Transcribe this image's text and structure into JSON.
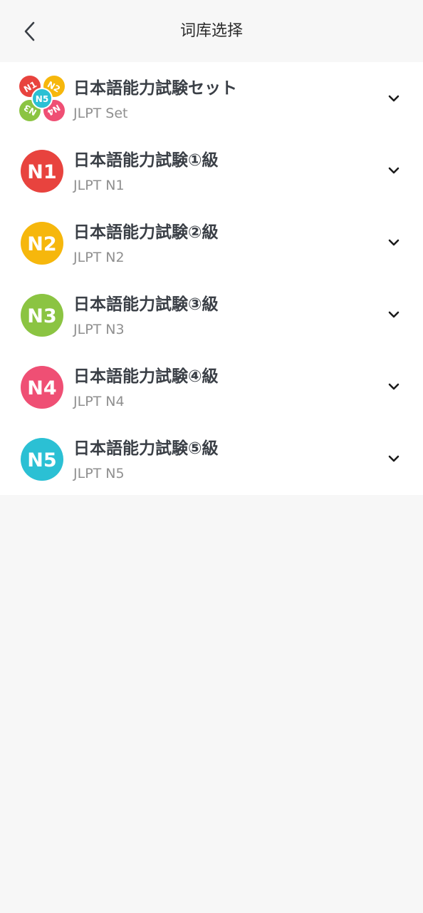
{
  "header": {
    "title": "词库选择",
    "back_icon": "chevron-left-icon"
  },
  "colors": {
    "n1": "#e8433e",
    "n2": "#f6b70c",
    "n3": "#8bc442",
    "n4": "#ef4f74",
    "n5": "#2bc0d4",
    "title_text": "#3a3f46",
    "subtitle_text": "#8f8f8f",
    "background": "#f7f7f7"
  },
  "items": [
    {
      "title": "日本語能力試験セット",
      "subtitle": "JLPT Set",
      "icon": "jlpt-set-logo-icon",
      "logo_labels": [
        "N1",
        "N2",
        "N3",
        "N4",
        "N5"
      ]
    },
    {
      "title": "日本語能力試験①級",
      "subtitle": "JLPT N1",
      "icon": "n1-logo-icon",
      "logo_label": "N1"
    },
    {
      "title": "日本語能力試験②級",
      "subtitle": "JLPT N2",
      "icon": "n2-logo-icon",
      "logo_label": "N2"
    },
    {
      "title": "日本語能力試験③級",
      "subtitle": "JLPT N3",
      "icon": "n3-logo-icon",
      "logo_label": "N3"
    },
    {
      "title": "日本語能力試験④級",
      "subtitle": "JLPT N4",
      "icon": "n4-logo-icon",
      "logo_label": "N4"
    },
    {
      "title": "日本語能力試験⑤級",
      "subtitle": "JLPT N5",
      "icon": "n5-logo-icon",
      "logo_label": "N5"
    }
  ]
}
